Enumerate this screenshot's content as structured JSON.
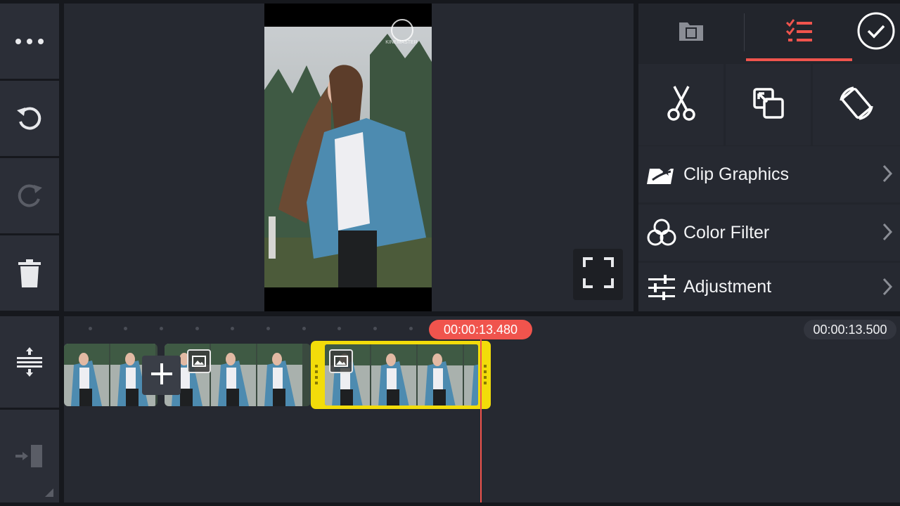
{
  "left_toolbar": {
    "icons": [
      "more-icon",
      "undo-icon",
      "redo-icon",
      "delete-icon",
      "layer-expand-icon",
      "export-icon"
    ]
  },
  "preview": {
    "watermark_text": "KINEMASTER",
    "fullscreen_icon": "fullscreen-icon"
  },
  "right_panel": {
    "tabs": [
      {
        "icon": "media-browser-icon",
        "active": false
      },
      {
        "icon": "edit-list-icon",
        "active": true
      }
    ],
    "confirm_icon": "check-circle-icon",
    "tools": [
      {
        "icon": "scissors-icon"
      },
      {
        "icon": "crop-icon"
      },
      {
        "icon": "rotate-icon"
      }
    ],
    "menu": [
      {
        "label": "Clip Graphics",
        "icon": "clip-graphics-icon"
      },
      {
        "label": "Color Filter",
        "icon": "color-filter-icon"
      },
      {
        "label": "Adjustment",
        "icon": "adjustment-sliders-icon"
      }
    ]
  },
  "timeline": {
    "current_time": "00:00:13.480",
    "total_time": "00:00:13.500"
  },
  "colors": {
    "accent": "#f0544d",
    "selection": "#f2dc0a",
    "panel": "#262931",
    "background": "#16181d"
  }
}
